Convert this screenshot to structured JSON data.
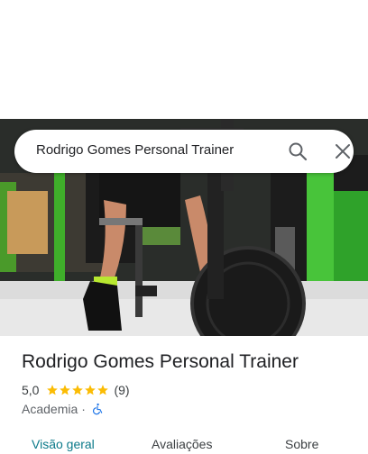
{
  "search": {
    "query": "Rodrigo Gomes Personal Trainer"
  },
  "place": {
    "name": "Rodrigo Gomes Personal Trainer",
    "rating": "5,0",
    "stars": 5,
    "review_count": "(9)",
    "category": "Academia",
    "separator": "·",
    "accessibility_icon": "wheelchair-icon"
  },
  "tabs": [
    {
      "label": "Visão geral",
      "active": true
    },
    {
      "label": "Avaliações",
      "active": false
    },
    {
      "label": "Sobre",
      "active": false
    }
  ],
  "colors": {
    "accent": "#0b7a8a",
    "star": "#fbbc04",
    "accessibility": "#1a73e8"
  }
}
